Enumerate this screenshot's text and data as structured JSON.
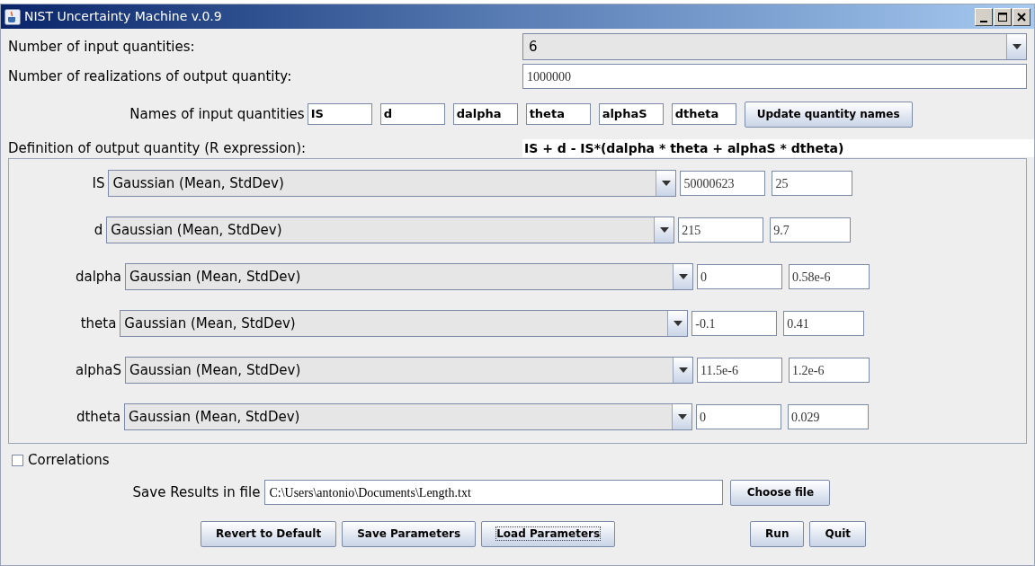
{
  "window": {
    "title": "NIST Uncertainty Machine v.0.9",
    "controls": [
      {
        "kind": "minimize"
      },
      {
        "kind": "maximize"
      },
      {
        "kind": "close"
      }
    ]
  },
  "num_inputs": {
    "label": "Number of input quantities:",
    "value": "6"
  },
  "num_realizations": {
    "label": "Number of realizations of output quantity:",
    "value": "1000000"
  },
  "names": {
    "label": "Names of input quantities",
    "values": [
      "IS",
      "d",
      "dalpha",
      "theta",
      "alphaS",
      "dtheta"
    ],
    "button": "Update quantity names"
  },
  "definition": {
    "label": "Definition of output quantity (R expression):",
    "value": "IS + d - IS*(dalpha * theta + alphaS * dtheta)"
  },
  "quantities": [
    {
      "name": "IS",
      "distribution": "Gaussian (Mean, StdDev)",
      "params": [
        "50000623",
        "25"
      ]
    },
    {
      "name": "d",
      "distribution": "Gaussian (Mean, StdDev)",
      "params": [
        "215",
        "9.7"
      ]
    },
    {
      "name": "dalpha",
      "distribution": "Gaussian (Mean, StdDev)",
      "params": [
        "0",
        "0.58e-6"
      ]
    },
    {
      "name": "theta",
      "distribution": "Gaussian (Mean, StdDev)",
      "params": [
        "-0.1",
        "0.41"
      ]
    },
    {
      "name": "alphaS",
      "distribution": "Gaussian (Mean, StdDev)",
      "params": [
        "11.5e-6",
        "1.2e-6"
      ]
    },
    {
      "name": "dtheta",
      "distribution": "Gaussian (Mean, StdDev)",
      "params": [
        "0",
        "0.029"
      ]
    }
  ],
  "correlations": {
    "label": "Correlations",
    "checked": false
  },
  "save": {
    "label": "Save Results in file",
    "value": "C:\\Users\\antonio\\Documents\\Length.txt",
    "button": "Choose file"
  },
  "buttons": [
    {
      "label": "Revert to Default",
      "focused": false
    },
    {
      "label": "Save Parameters",
      "focused": false
    },
    {
      "label": "Load Parameters",
      "focused": true
    },
    {
      "label": "Run",
      "focused": false
    },
    {
      "label": "Quit",
      "focused": false
    }
  ]
}
